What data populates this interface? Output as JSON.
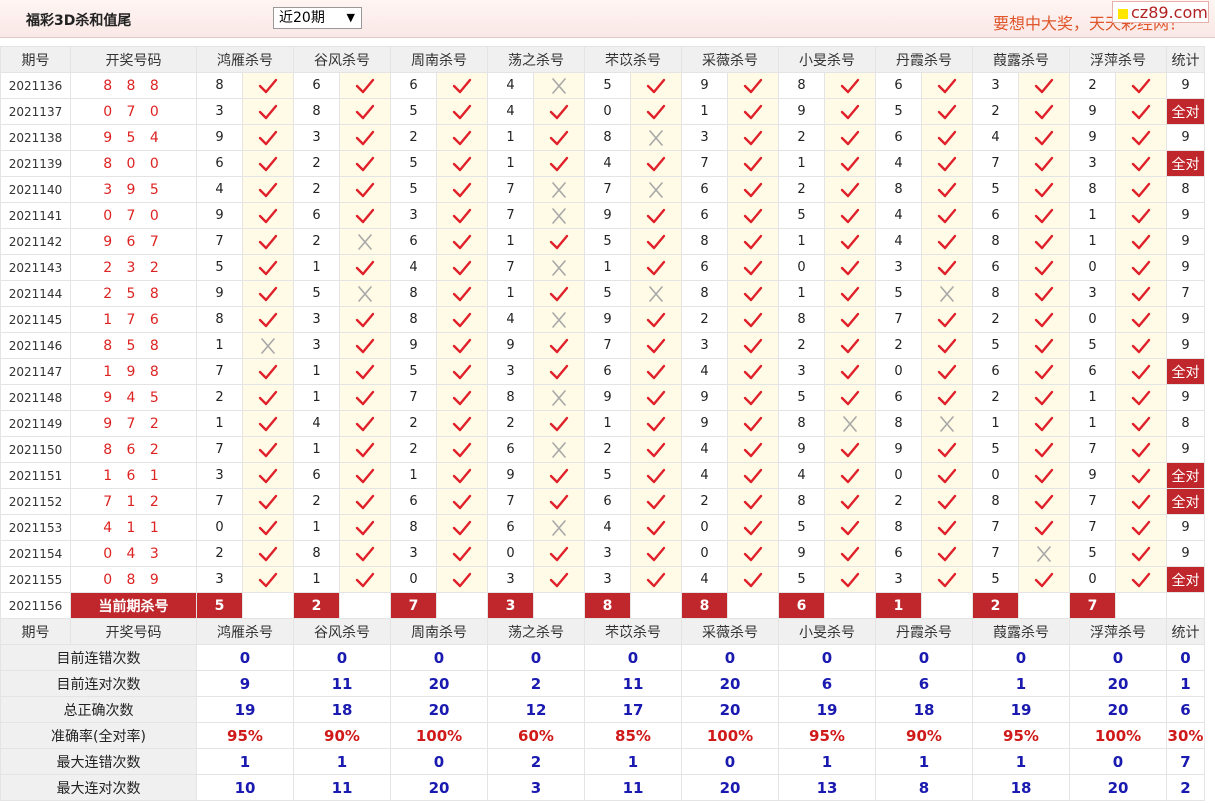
{
  "app_title": "福彩3D杀和值尾",
  "period_select": {
    "selected": "近20期"
  },
  "slogan": "要想中大奖，天天彩经网！",
  "brand": "cz89.com",
  "headers": {
    "period": "期号",
    "draw": "开奖号码",
    "stat": "统计"
  },
  "experts": [
    "鸿雁杀号",
    "谷风杀号",
    "周南杀号",
    "荡之杀号",
    "芣苡杀号",
    "采薇杀号",
    "小旻杀号",
    "丹霞杀号",
    "葭露杀号",
    "浮萍杀号"
  ],
  "rows": [
    {
      "period": "2021136",
      "draw": "8 8 8",
      "kills": [
        8,
        6,
        6,
        4,
        5,
        9,
        8,
        6,
        3,
        2
      ],
      "results": [
        1,
        1,
        1,
        0,
        1,
        1,
        1,
        1,
        1,
        1
      ],
      "stat": "9",
      "full": false
    },
    {
      "period": "2021137",
      "draw": "0 7 0",
      "kills": [
        3,
        8,
        5,
        4,
        0,
        1,
        9,
        5,
        2,
        9
      ],
      "results": [
        1,
        1,
        1,
        1,
        1,
        1,
        1,
        1,
        1,
        1
      ],
      "stat": "全对",
      "full": true
    },
    {
      "period": "2021138",
      "draw": "9 5 4",
      "kills": [
        9,
        3,
        2,
        1,
        8,
        3,
        2,
        6,
        4,
        9
      ],
      "results": [
        1,
        1,
        1,
        1,
        0,
        1,
        1,
        1,
        1,
        1
      ],
      "stat": "9",
      "full": false
    },
    {
      "period": "2021139",
      "draw": "8 0 0",
      "kills": [
        6,
        2,
        5,
        1,
        4,
        7,
        1,
        4,
        7,
        3
      ],
      "results": [
        1,
        1,
        1,
        1,
        1,
        1,
        1,
        1,
        1,
        1
      ],
      "stat": "全对",
      "full": true
    },
    {
      "period": "2021140",
      "draw": "3 9 5",
      "kills": [
        4,
        2,
        5,
        7,
        7,
        6,
        2,
        8,
        5,
        8
      ],
      "results": [
        1,
        1,
        1,
        0,
        0,
        1,
        1,
        1,
        1,
        1
      ],
      "stat": "8",
      "full": false
    },
    {
      "period": "2021141",
      "draw": "0 7 0",
      "kills": [
        9,
        6,
        3,
        7,
        9,
        6,
        5,
        4,
        6,
        1
      ],
      "results": [
        1,
        1,
        1,
        0,
        1,
        1,
        1,
        1,
        1,
        1
      ],
      "stat": "9",
      "full": false
    },
    {
      "period": "2021142",
      "draw": "9 6 7",
      "kills": [
        7,
        2,
        6,
        1,
        5,
        8,
        1,
        4,
        8,
        1
      ],
      "results": [
        1,
        0,
        1,
        1,
        1,
        1,
        1,
        1,
        1,
        1
      ],
      "stat": "9",
      "full": false
    },
    {
      "period": "2021143",
      "draw": "2 3 2",
      "kills": [
        5,
        1,
        4,
        7,
        1,
        6,
        0,
        3,
        6,
        0
      ],
      "results": [
        1,
        1,
        1,
        0,
        1,
        1,
        1,
        1,
        1,
        1
      ],
      "stat": "9",
      "full": false
    },
    {
      "period": "2021144",
      "draw": "2 5 8",
      "kills": [
        9,
        5,
        8,
        1,
        5,
        8,
        1,
        5,
        8,
        3
      ],
      "results": [
        1,
        0,
        1,
        1,
        0,
        1,
        1,
        0,
        1,
        1
      ],
      "stat": "7",
      "full": false
    },
    {
      "period": "2021145",
      "draw": "1 7 6",
      "kills": [
        8,
        3,
        8,
        4,
        9,
        2,
        8,
        7,
        2,
        0
      ],
      "results": [
        1,
        1,
        1,
        0,
        1,
        1,
        1,
        1,
        1,
        1
      ],
      "stat": "9",
      "full": false
    },
    {
      "period": "2021146",
      "draw": "8 5 8",
      "kills": [
        1,
        3,
        9,
        9,
        7,
        3,
        2,
        2,
        5,
        5
      ],
      "results": [
        0,
        1,
        1,
        1,
        1,
        1,
        1,
        1,
        1,
        1
      ],
      "stat": "9",
      "full": false
    },
    {
      "period": "2021147",
      "draw": "1 9 8",
      "kills": [
        7,
        1,
        5,
        3,
        6,
        4,
        3,
        0,
        6,
        6
      ],
      "results": [
        1,
        1,
        1,
        1,
        1,
        1,
        1,
        1,
        1,
        1
      ],
      "stat": "全对",
      "full": true
    },
    {
      "period": "2021148",
      "draw": "9 4 5",
      "kills": [
        2,
        1,
        7,
        8,
        9,
        9,
        5,
        6,
        2,
        1
      ],
      "results": [
        1,
        1,
        1,
        0,
        1,
        1,
        1,
        1,
        1,
        1
      ],
      "stat": "9",
      "full": false
    },
    {
      "period": "2021149",
      "draw": "9 7 2",
      "kills": [
        1,
        4,
        2,
        2,
        1,
        9,
        8,
        8,
        1,
        1
      ],
      "results": [
        1,
        1,
        1,
        1,
        1,
        1,
        0,
        0,
        1,
        1
      ],
      "stat": "8",
      "full": false
    },
    {
      "period": "2021150",
      "draw": "8 6 2",
      "kills": [
        7,
        1,
        2,
        6,
        2,
        4,
        9,
        9,
        5,
        7
      ],
      "results": [
        1,
        1,
        1,
        0,
        1,
        1,
        1,
        1,
        1,
        1
      ],
      "stat": "9",
      "full": false
    },
    {
      "period": "2021151",
      "draw": "1 6 1",
      "kills": [
        3,
        6,
        1,
        9,
        5,
        4,
        4,
        0,
        0,
        9
      ],
      "results": [
        1,
        1,
        1,
        1,
        1,
        1,
        1,
        1,
        1,
        1
      ],
      "stat": "全对",
      "full": true
    },
    {
      "period": "2021152",
      "draw": "7 1 2",
      "kills": [
        7,
        2,
        6,
        7,
        6,
        2,
        8,
        2,
        8,
        7
      ],
      "results": [
        1,
        1,
        1,
        1,
        1,
        1,
        1,
        1,
        1,
        1
      ],
      "stat": "全对",
      "full": true
    },
    {
      "period": "2021153",
      "draw": "4 1 1",
      "kills": [
        0,
        1,
        8,
        6,
        4,
        0,
        5,
        8,
        7,
        7
      ],
      "results": [
        1,
        1,
        1,
        0,
        1,
        1,
        1,
        1,
        1,
        1
      ],
      "stat": "9",
      "full": false
    },
    {
      "period": "2021154",
      "draw": "0 4 3",
      "kills": [
        2,
        8,
        3,
        0,
        3,
        0,
        9,
        6,
        7,
        5
      ],
      "results": [
        1,
        1,
        1,
        1,
        1,
        1,
        1,
        1,
        0,
        1
      ],
      "stat": "9",
      "full": false
    },
    {
      "period": "2021155",
      "draw": "0 8 9",
      "kills": [
        3,
        1,
        0,
        3,
        3,
        4,
        5,
        3,
        5,
        0
      ],
      "results": [
        1,
        1,
        1,
        1,
        1,
        1,
        1,
        1,
        1,
        1
      ],
      "stat": "全对",
      "full": true
    }
  ],
  "current": {
    "period": "2021156",
    "label": "当前期杀号",
    "kills": [
      5,
      2,
      7,
      3,
      8,
      8,
      6,
      1,
      2,
      7
    ]
  },
  "stats": [
    {
      "label": "目前连错次数",
      "values": [
        "0",
        "0",
        "0",
        "0",
        "0",
        "0",
        "0",
        "0",
        "0",
        "0"
      ],
      "total": "0",
      "red": false
    },
    {
      "label": "目前连对次数",
      "values": [
        "9",
        "11",
        "20",
        "2",
        "11",
        "20",
        "6",
        "6",
        "1",
        "20"
      ],
      "total": "1",
      "red": false
    },
    {
      "label": "总正确次数",
      "values": [
        "19",
        "18",
        "20",
        "12",
        "17",
        "20",
        "19",
        "18",
        "19",
        "20"
      ],
      "total": "6",
      "red": false
    },
    {
      "label": "准确率(全对率)",
      "values": [
        "95%",
        "90%",
        "100%",
        "60%",
        "85%",
        "100%",
        "95%",
        "90%",
        "95%",
        "100%"
      ],
      "total": "30%",
      "red": true
    },
    {
      "label": "最大连错次数",
      "values": [
        "1",
        "1",
        "0",
        "2",
        "1",
        "0",
        "1",
        "1",
        "1",
        "0"
      ],
      "total": "7",
      "red": false
    },
    {
      "label": "最大连对次数",
      "values": [
        "10",
        "11",
        "20",
        "3",
        "11",
        "20",
        "13",
        "8",
        "18",
        "20"
      ],
      "total": "2",
      "red": false
    }
  ]
}
